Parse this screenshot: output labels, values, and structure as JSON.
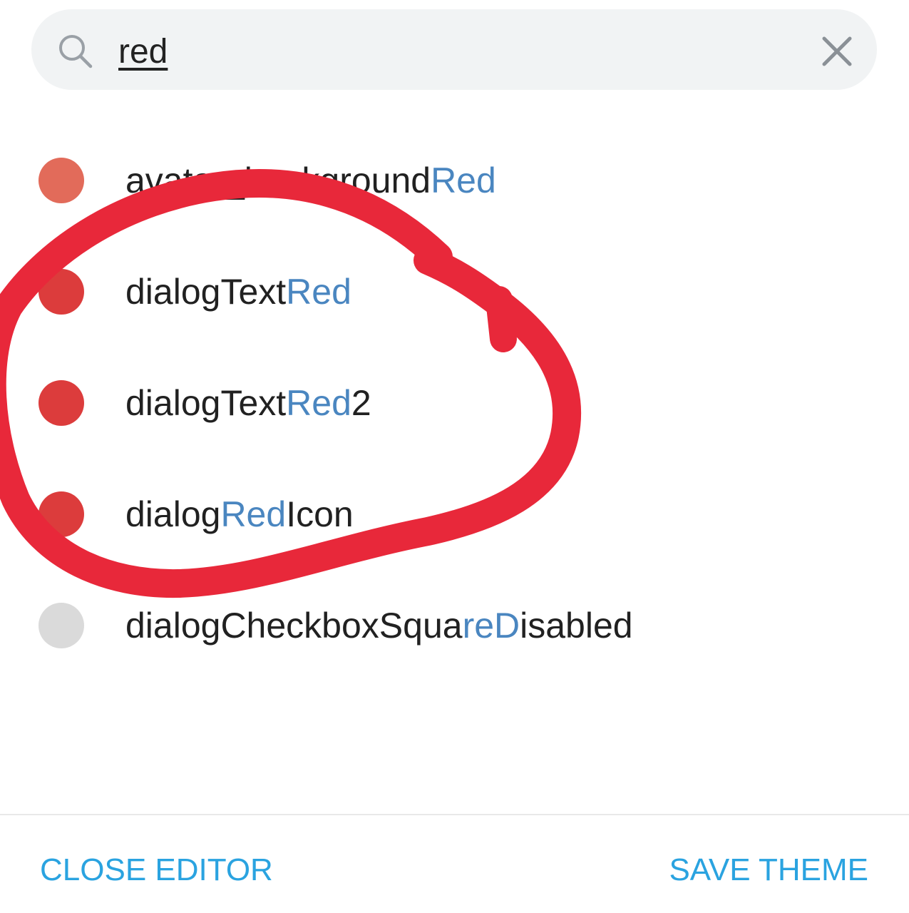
{
  "search": {
    "value": "red",
    "icons": {
      "search": "search-icon",
      "clear": "close-icon"
    }
  },
  "colors": [
    {
      "pre": "avatar_background",
      "match": "Red",
      "post": "",
      "swatch": "#e26b5a"
    },
    {
      "pre": "dialogText",
      "match": "Red",
      "post": "",
      "swatch": "#dc3c3c"
    },
    {
      "pre": "dialogText",
      "match": "Red",
      "post": "2",
      "swatch": "#dc3c3c"
    },
    {
      "pre": "dialog",
      "match": "Red",
      "post": "Icon",
      "swatch": "#dc3c3c"
    },
    {
      "pre": "dialogCheckboxSqua",
      "match": "reD",
      "post": "isabled",
      "swatch": "#dadada"
    }
  ],
  "footer": {
    "close_label": "CLOSE EDITOR",
    "save_label": "SAVE THEME"
  },
  "theme": {
    "accent": "#2aa3e0",
    "highlight": "#4a86c0",
    "annotation": "#e8283a"
  }
}
